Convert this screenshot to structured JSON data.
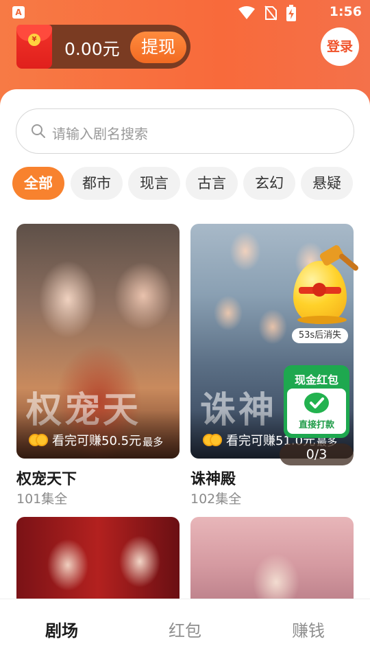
{
  "status_bar": {
    "time": "1:56",
    "icons": [
      "notification-a-icon",
      "wifi-icon",
      "no-sim-icon",
      "battery-charging-icon"
    ]
  },
  "wallet": {
    "balance": "0.00元",
    "withdraw_label": "提现"
  },
  "header": {
    "login_label": "登录"
  },
  "search": {
    "placeholder": "请输入剧名搜索"
  },
  "tabs": [
    {
      "label": "全部",
      "active": true
    },
    {
      "label": "都市",
      "active": false
    },
    {
      "label": "现言",
      "active": false
    },
    {
      "label": "古言",
      "active": false
    },
    {
      "label": "玄幻",
      "active": false
    },
    {
      "label": "悬疑",
      "active": false
    }
  ],
  "dramas": [
    {
      "title": "权宠天下",
      "episodes": "101集全",
      "earn": "看完可赚50.5元",
      "earn_suffix": "最多",
      "poster_text": "权宠天"
    },
    {
      "title": "诛神殿",
      "episodes": "102集全",
      "earn": "看完可赚51.0元",
      "earn_suffix": "最多",
      "poster_text": "诛神"
    },
    {
      "title": "",
      "episodes": "",
      "earn": "",
      "earn_suffix": "",
      "poster_text": ""
    },
    {
      "title": "",
      "episodes": "",
      "earn": "",
      "earn_suffix": "",
      "poster_text": ""
    }
  ],
  "floating_egg": {
    "timer": "53s后消失"
  },
  "cash_card": {
    "title": "现金红包",
    "subtitle": "直接打款"
  },
  "progress": {
    "label": "0/3"
  },
  "bottom_nav": [
    {
      "label": "剧场",
      "active": true
    },
    {
      "label": "红包",
      "active": false
    },
    {
      "label": "赚钱",
      "active": false
    }
  ],
  "colors": {
    "accent": "#f8822e",
    "header": "#f86a3b",
    "wallet_bg": "#7a3b22",
    "cash_green": "#1ea84f"
  }
}
